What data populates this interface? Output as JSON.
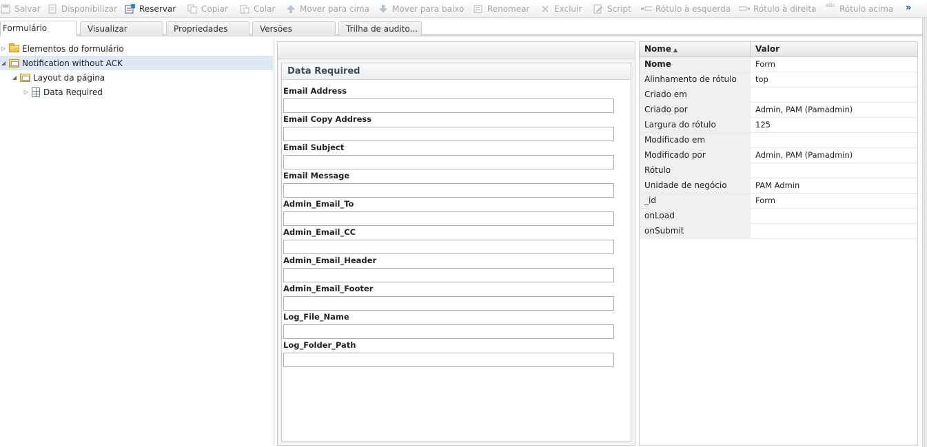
{
  "toolbar": {
    "buttons": [
      {
        "label": "Salvar",
        "icon": "save-icon",
        "enabled": false
      },
      {
        "label": "Disponibilizar",
        "icon": "publish-icon",
        "enabled": false
      },
      {
        "label": "Reservar",
        "icon": "checkout-icon",
        "enabled": true
      },
      {
        "label": "Copiar",
        "icon": "copy-icon",
        "enabled": false
      },
      {
        "label": "Colar",
        "icon": "paste-icon",
        "enabled": false
      },
      {
        "label": "Mover para cima",
        "icon": "arrow-up-icon",
        "enabled": false
      },
      {
        "label": "Mover para baixo",
        "icon": "arrow-down-icon",
        "enabled": false
      },
      {
        "label": "Renomear",
        "icon": "rename-icon",
        "enabled": false
      },
      {
        "label": "Excluir",
        "icon": "delete-icon",
        "enabled": false
      },
      {
        "label": "Script",
        "icon": "script-icon",
        "enabled": false
      },
      {
        "label": "Rótulo à esquerda",
        "icon": "label-left-icon",
        "enabled": false
      },
      {
        "label": "Rótulo à direita",
        "icon": "label-right-icon",
        "enabled": false
      },
      {
        "label": "Rótulo acima",
        "icon": "label-above-icon",
        "enabled": false
      }
    ],
    "more": "»",
    "label_above_icon_text": "abc"
  },
  "tabs": [
    {
      "label": "Formulário",
      "active": true
    },
    {
      "label": "Visualizar",
      "active": false
    },
    {
      "label": "Propriedades",
      "active": false
    },
    {
      "label": "Versões",
      "active": false
    },
    {
      "label": "Trilha de audito..."
    }
  ],
  "tree": {
    "items": [
      {
        "label": "Elementos do formulário",
        "expanded": false,
        "icon": "folder-icon"
      },
      {
        "label": "Notification without ACK",
        "expanded": true,
        "selected": true,
        "icon": "form-folder-icon"
      },
      {
        "label": "Layout da página",
        "expanded": true,
        "icon": "form-folder-icon"
      },
      {
        "label": "Data Required",
        "expanded": false,
        "icon": "page-grid-icon"
      }
    ]
  },
  "form": {
    "panel_title": "Data Required",
    "fields": [
      {
        "label": "Email Address",
        "value": ""
      },
      {
        "label": "Email Copy Address",
        "value": ""
      },
      {
        "label": "Email Subject",
        "value": ""
      },
      {
        "label": "Email Message",
        "value": ""
      },
      {
        "label": "Admin_Email_To",
        "value": ""
      },
      {
        "label": "Admin_Email_CC",
        "value": ""
      },
      {
        "label": "Admin_Email_Header",
        "value": ""
      },
      {
        "label": "Admin_Email_Footer",
        "value": ""
      },
      {
        "label": "Log_File_Name",
        "value": ""
      },
      {
        "label": "Log_Folder_Path",
        "value": ""
      }
    ]
  },
  "properties": {
    "col_name": "Nome",
    "col_value": "Valor",
    "sort": "ascending",
    "rows": [
      {
        "name": "Nome",
        "value": "Form",
        "bold": true
      },
      {
        "name": "Alinhamento de rótulo",
        "value": "top"
      },
      {
        "name": "Criado em",
        "value": ""
      },
      {
        "name": "Criado por",
        "value": "Admin, PAM (Pamadmin)"
      },
      {
        "name": "Largura do rótulo",
        "value": "125"
      },
      {
        "name": "Modificado em",
        "value": ""
      },
      {
        "name": "Modificado por",
        "value": "Admin, PAM (Pamadmin)"
      },
      {
        "name": "Rótulo",
        "value": ""
      },
      {
        "name": "Unidade de negócio",
        "value": "PAM Admin"
      },
      {
        "name": "_id",
        "value": "Form"
      },
      {
        "name": "onLoad",
        "value": ""
      },
      {
        "name": "onSubmit",
        "value": ""
      }
    ]
  }
}
